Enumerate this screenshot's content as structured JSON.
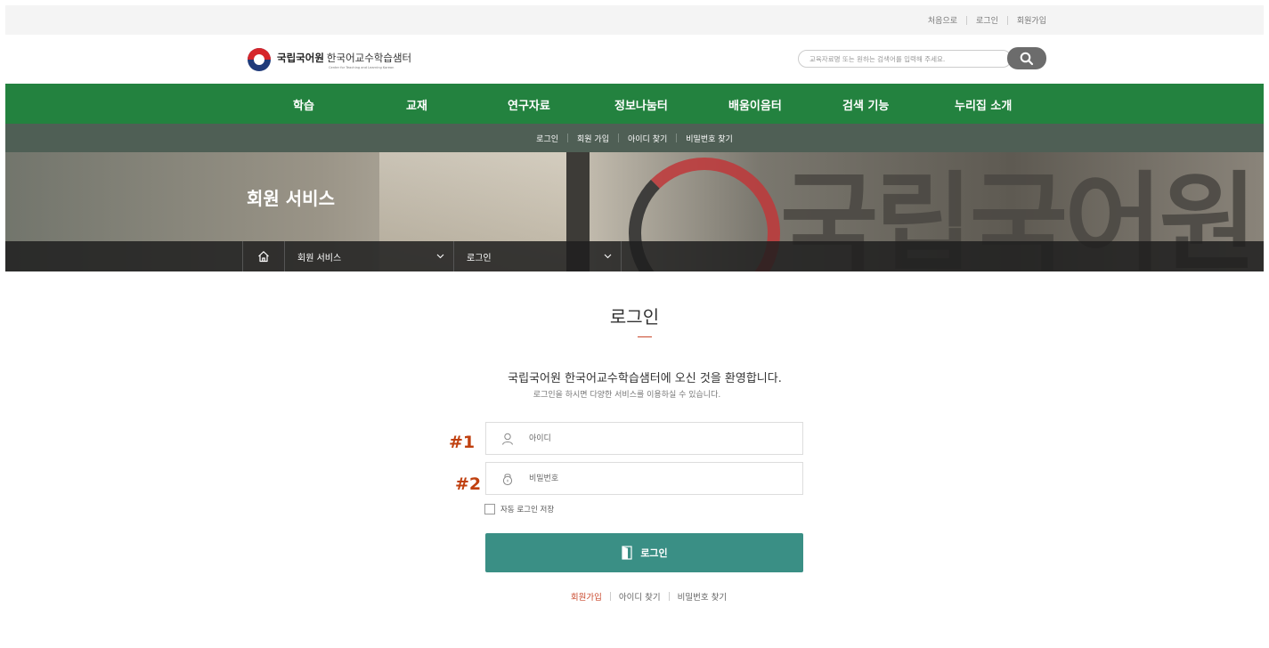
{
  "top_links": [
    "처음으로",
    "로그인",
    "회원가입"
  ],
  "logo": {
    "name": "국립국어원",
    "center": "한국어교수학습샘터",
    "sub": "Center for Teaching and Learning Korean"
  },
  "search": {
    "placeholder": "교육자료명 또는 원하는 검색어를 입력해 주세요."
  },
  "gnb": [
    "학습",
    "교재",
    "연구자료",
    "정보나눔터",
    "배움이음터",
    "검색 기능",
    "누리집 소개"
  ],
  "sub_nav": [
    "로그인",
    "회원 가입",
    "아이디 찾기",
    "비밀번호 찾기"
  ],
  "hero": {
    "title": "회원 서비스",
    "bg_text": "국립국어원"
  },
  "breadcrumb": {
    "level1": "회원 서비스",
    "level2": "로그인"
  },
  "login": {
    "title": "로그인",
    "welcome": "국립국어원 한국어교수학습샘터에 오신 것을 환영합니다.",
    "welcome_sub": "로그인을 하시면 다양한 서비스를 이용하실 수 있습니다.",
    "id_placeholder": "아이디",
    "pw_placeholder": "비밀번호",
    "id_marker": "#1",
    "pw_marker": "#2",
    "remember_label": "자동 로그인 저장",
    "submit_label": "로그인",
    "signup_link": "회원가입",
    "find_id_link": "아이디 찾기",
    "find_pw_link": "비밀번호 찾기"
  },
  "colors": {
    "gnb_green": "#23823f",
    "sub_nav": "#4f5f55",
    "button_teal": "#3a8f85",
    "accent_red": "#c9472b",
    "marker_orange": "#c0400f"
  }
}
